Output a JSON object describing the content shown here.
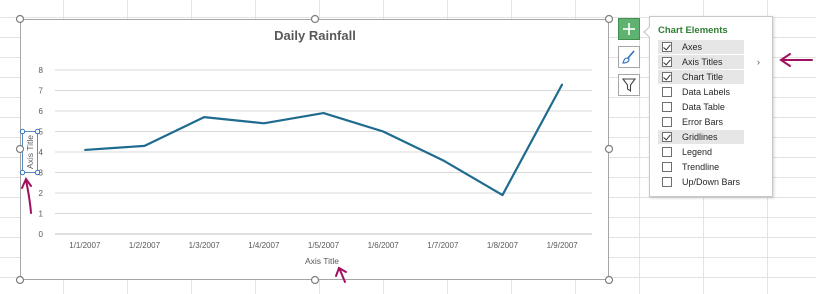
{
  "chart_data": {
    "type": "line",
    "title": "Daily Rainfall",
    "categories": [
      "1/1/2007",
      "1/2/2007",
      "1/3/2007",
      "1/4/2007",
      "1/5/2007",
      "1/6/2007",
      "1/7/2007",
      "1/8/2007",
      "1/9/2007"
    ],
    "series": [
      {
        "values": [
          4.1,
          4.3,
          5.7,
          5.4,
          5.9,
          5.0,
          3.6,
          1.9,
          7.3
        ]
      }
    ],
    "y_ticks": [
      "0",
      "1",
      "2",
      "3",
      "4",
      "5",
      "6",
      "7",
      "8"
    ],
    "ylim": [
      0,
      8
    ],
    "xlabel": "Axis Title",
    "ylabel": "Axis Title",
    "grid": true,
    "line_color": "#1f6b8f"
  },
  "panel": {
    "title": "Chart Elements",
    "options": [
      {
        "label": "Axes",
        "checked": true
      },
      {
        "label": "Axis Titles",
        "checked": true
      },
      {
        "label": "Chart Title",
        "checked": true
      },
      {
        "label": "Data Labels",
        "checked": false
      },
      {
        "label": "Data Table",
        "checked": false
      },
      {
        "label": "Error Bars",
        "checked": false
      },
      {
        "label": "Gridlines",
        "checked": true
      },
      {
        "label": "Legend",
        "checked": false
      },
      {
        "label": "Trendline",
        "checked": false
      },
      {
        "label": "Up/Down Bars",
        "checked": false
      }
    ],
    "chevron": "›"
  },
  "buttons": {
    "elements_icon": "plus-icon",
    "styles_icon": "brush-icon",
    "filters_icon": "filter-icon"
  },
  "colors": {
    "accent_green": "#5fb26f",
    "annotation_arrow": "#a0105f",
    "gridline": "#d9d9d9"
  }
}
